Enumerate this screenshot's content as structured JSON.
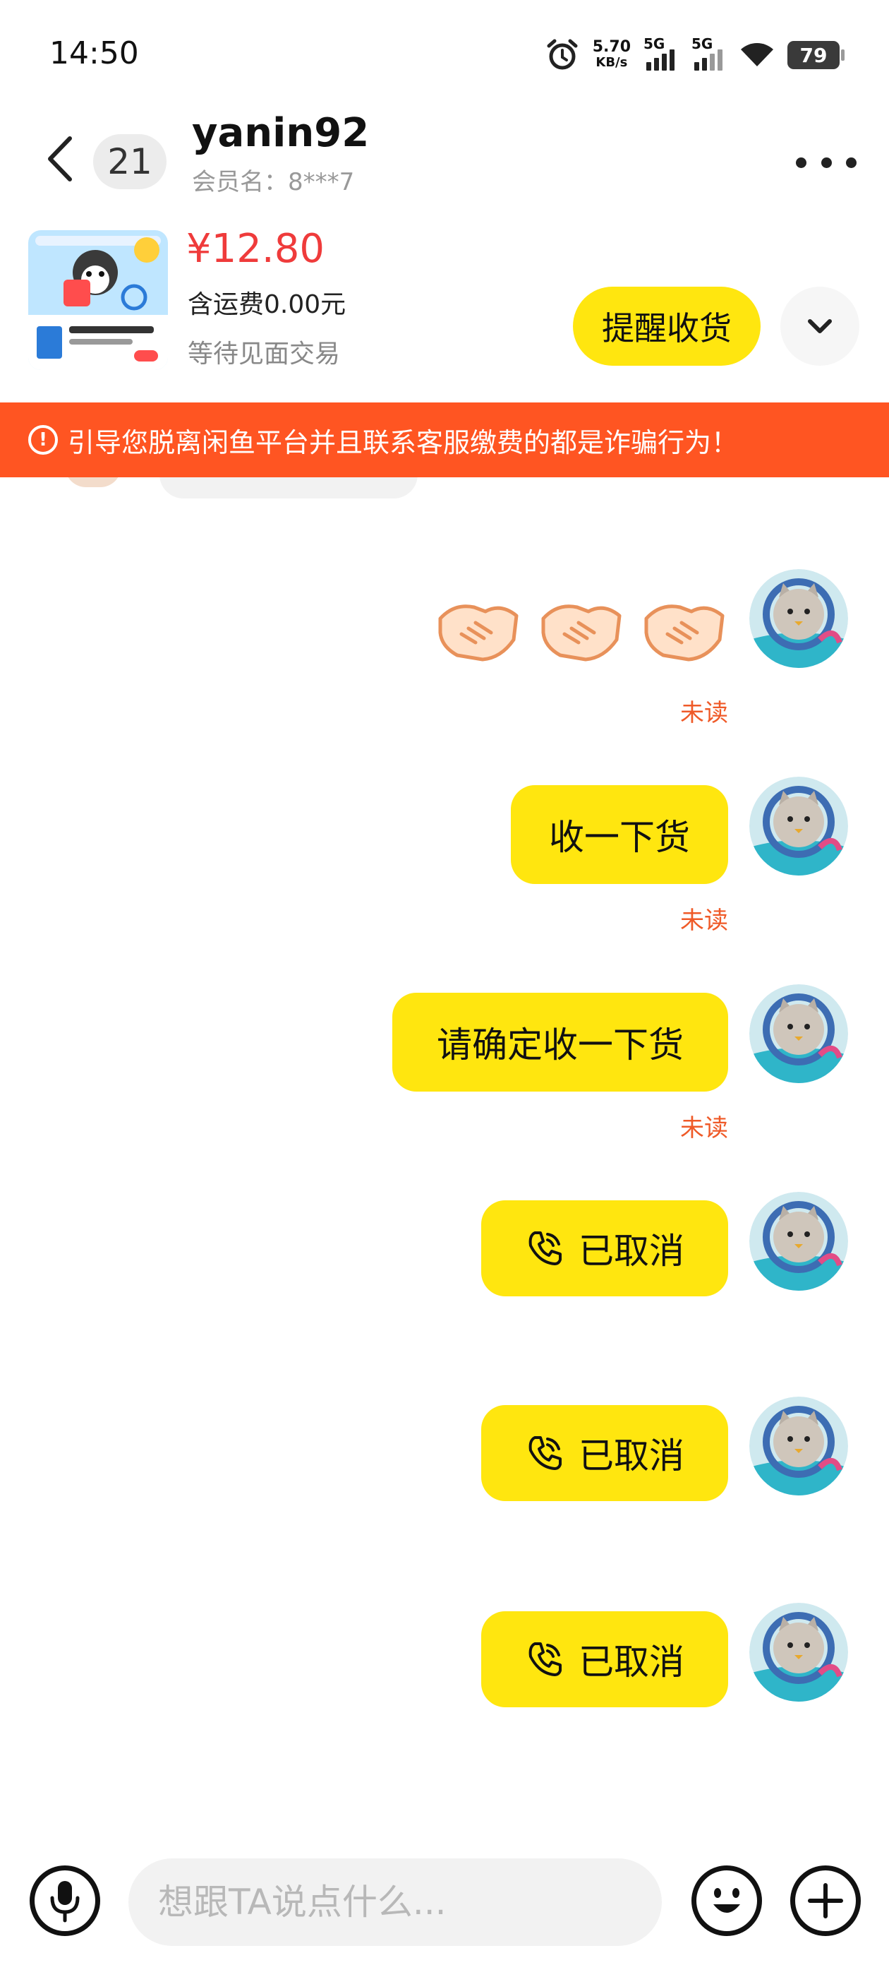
{
  "status_bar": {
    "time": "14:50",
    "net_speed_value": "5.70",
    "net_speed_unit": "KB/s",
    "signal_1": "5G",
    "signal_2": "5G",
    "battery": "79"
  },
  "header": {
    "unread_count": "21",
    "nickname": "yanin92",
    "member_name": "会员名：8***7"
  },
  "order": {
    "price": "¥12.80",
    "shipping": "含运费0.00元",
    "status": "等待见面交易",
    "remind_label": "提醒收货"
  },
  "warning": {
    "text": "引导您脱离闲鱼平台并且联系客服缴费的都是诈骗行为！"
  },
  "messages": [
    {
      "type": "emoji",
      "emoji": "handshake",
      "count": 3,
      "status": "未读"
    },
    {
      "type": "text",
      "text": "收一下货",
      "status": "未读"
    },
    {
      "type": "text",
      "text": "请确定收一下货",
      "status": "未读"
    },
    {
      "type": "call",
      "text": "已取消"
    },
    {
      "type": "call",
      "text": "已取消"
    },
    {
      "type": "call",
      "text": "已取消"
    }
  ],
  "input": {
    "placeholder": "想跟TA说点什么..."
  },
  "colors": {
    "accent_yellow": "#ffe60f",
    "warning_orange": "#ff5522",
    "price_red": "#ef3b3b",
    "unread_orange": "#ef5a28"
  }
}
